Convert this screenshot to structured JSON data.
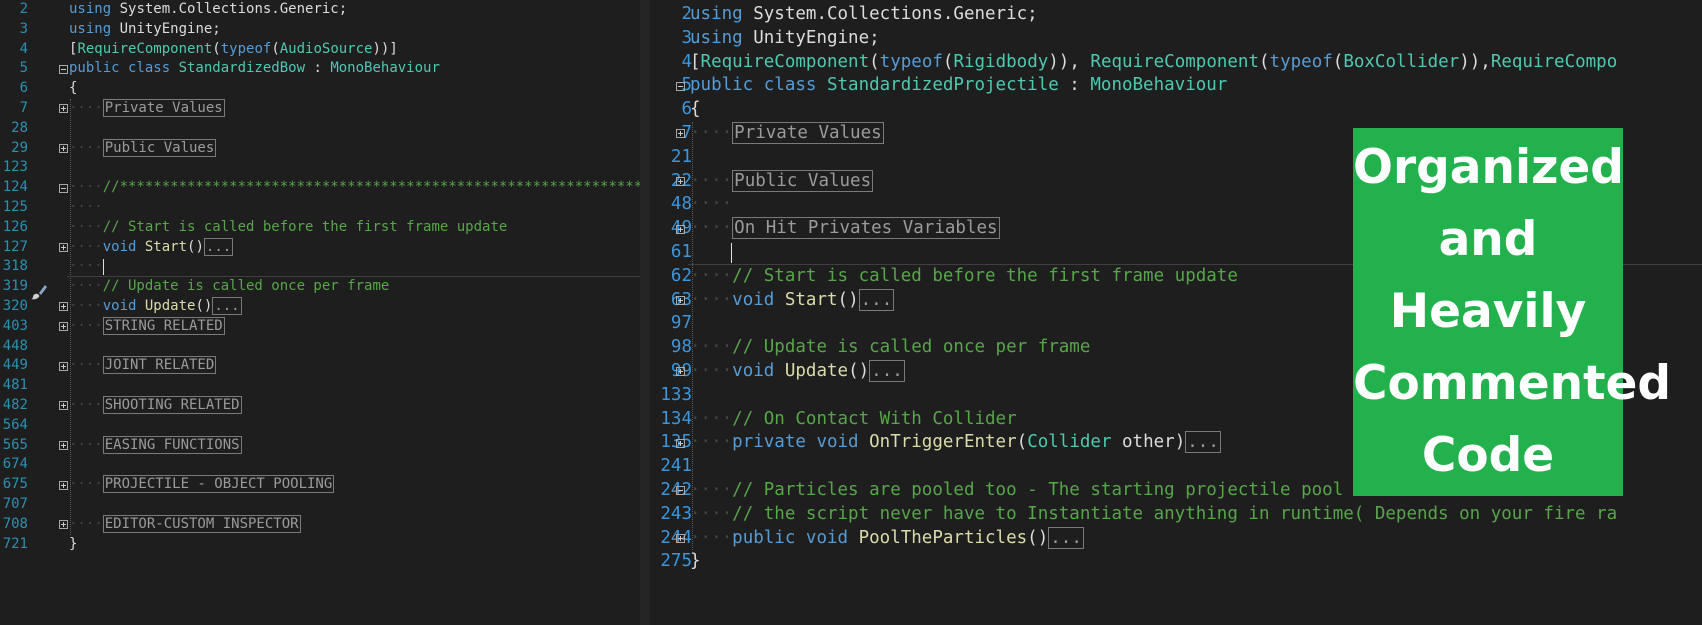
{
  "left_editor": {
    "lines": [
      {
        "num": "2",
        "fold": "",
        "indent": 0,
        "segs": [
          {
            "c": "kw",
            "t": "using"
          },
          {
            "c": "tx",
            "t": " System.Collections.Generic;"
          }
        ]
      },
      {
        "num": "3",
        "fold": "",
        "indent": 0,
        "segs": [
          {
            "c": "kw",
            "t": "using"
          },
          {
            "c": "tx",
            "t": " UnityEngine;"
          }
        ]
      },
      {
        "num": "4",
        "fold": "",
        "indent": 0,
        "segs": [
          {
            "c": "tx",
            "t": "["
          },
          {
            "c": "tp",
            "t": "RequireComponent"
          },
          {
            "c": "tx",
            "t": "("
          },
          {
            "c": "kw",
            "t": "typeof"
          },
          {
            "c": "tx",
            "t": "("
          },
          {
            "c": "tp",
            "t": "AudioSource"
          },
          {
            "c": "tx",
            "t": "))]"
          }
        ]
      },
      {
        "num": "5",
        "fold": "minus",
        "indent": 0,
        "segs": [
          {
            "c": "kw",
            "t": "public class "
          },
          {
            "c": "tp",
            "t": "StandardizedBow"
          },
          {
            "c": "tx",
            "t": " : "
          },
          {
            "c": "tp",
            "t": "MonoBehaviour"
          }
        ]
      },
      {
        "num": "6",
        "fold": "",
        "indent": 0,
        "segs": [
          {
            "c": "tx",
            "t": "{"
          }
        ]
      },
      {
        "num": "7",
        "fold": "plus",
        "indent": 1,
        "segs": [
          {
            "c": "reg",
            "t": "Private Values"
          }
        ]
      },
      {
        "num": "28",
        "fold": "",
        "indent": 0,
        "segs": []
      },
      {
        "num": "29",
        "fold": "plus",
        "indent": 1,
        "segs": [
          {
            "c": "reg",
            "t": "Public Values"
          }
        ]
      },
      {
        "num": "123",
        "fold": "",
        "indent": 0,
        "segs": []
      },
      {
        "num": "124",
        "fold": "minus",
        "indent": 1,
        "segs": [
          {
            "c": "cm",
            "t": "//*************************************************************************"
          }
        ]
      },
      {
        "num": "125",
        "fold": "",
        "indent": 1,
        "segs": []
      },
      {
        "num": "126",
        "fold": "",
        "indent": 1,
        "segs": [
          {
            "c": "cm",
            "t": "// Start is called before the first frame update"
          }
        ]
      },
      {
        "num": "127",
        "fold": "plus",
        "indent": 1,
        "segs": [
          {
            "c": "kw",
            "t": "void"
          },
          {
            "c": "tx",
            "t": " "
          },
          {
            "c": "fn",
            "t": "Start"
          },
          {
            "c": "tx",
            "t": "()"
          },
          {
            "c": "ell",
            "t": "..."
          }
        ]
      },
      {
        "num": "318",
        "fold": "",
        "indent": 1,
        "segs": []
      },
      {
        "num": "319",
        "fold": "",
        "indent": 1,
        "segs": [
          {
            "c": "cm",
            "t": "// Update is called once per frame"
          }
        ]
      },
      {
        "num": "320",
        "fold": "plus",
        "indent": 1,
        "segs": [
          {
            "c": "kw",
            "t": "void"
          },
          {
            "c": "tx",
            "t": " "
          },
          {
            "c": "fn",
            "t": "Update"
          },
          {
            "c": "tx",
            "t": "()"
          },
          {
            "c": "ell",
            "t": "..."
          }
        ]
      },
      {
        "num": "403",
        "fold": "plus",
        "indent": 1,
        "segs": [
          {
            "c": "reg",
            "t": "STRING RELATED"
          }
        ]
      },
      {
        "num": "448",
        "fold": "",
        "indent": 0,
        "segs": []
      },
      {
        "num": "449",
        "fold": "plus",
        "indent": 1,
        "segs": [
          {
            "c": "reg",
            "t": "JOINT RELATED"
          }
        ]
      },
      {
        "num": "481",
        "fold": "",
        "indent": 0,
        "segs": []
      },
      {
        "num": "482",
        "fold": "plus",
        "indent": 1,
        "segs": [
          {
            "c": "reg",
            "t": "SHOOTING RELATED"
          }
        ]
      },
      {
        "num": "564",
        "fold": "",
        "indent": 0,
        "segs": []
      },
      {
        "num": "565",
        "fold": "plus",
        "indent": 1,
        "segs": [
          {
            "c": "reg",
            "t": "EASING FUNCTIONS"
          }
        ]
      },
      {
        "num": "674",
        "fold": "",
        "indent": 0,
        "segs": []
      },
      {
        "num": "675",
        "fold": "plus",
        "indent": 1,
        "segs": [
          {
            "c": "reg",
            "t": "PROJECTILE - OBJECT POOLING"
          }
        ]
      },
      {
        "num": "707",
        "fold": "",
        "indent": 0,
        "segs": []
      },
      {
        "num": "708",
        "fold": "plus",
        "indent": 1,
        "segs": [
          {
            "c": "reg",
            "t": "EDITOR-CUSTOM INSPECTOR"
          }
        ]
      },
      {
        "num": "721",
        "fold": "",
        "indent": 0,
        "segs": [
          {
            "c": "tx",
            "t": "}"
          }
        ]
      }
    ]
  },
  "right_editor": {
    "lines": [
      {
        "num": "2",
        "fold": "",
        "indent": 0,
        "segs": [
          {
            "c": "kw",
            "t": "using"
          },
          {
            "c": "tx",
            "t": " System.Collections.Generic;"
          }
        ]
      },
      {
        "num": "3",
        "fold": "",
        "indent": 0,
        "segs": [
          {
            "c": "kw",
            "t": "using"
          },
          {
            "c": "tx",
            "t": " UnityEngine;"
          }
        ]
      },
      {
        "num": "4",
        "fold": "",
        "indent": 0,
        "segs": [
          {
            "c": "tx",
            "t": "["
          },
          {
            "c": "tp",
            "t": "RequireComponent"
          },
          {
            "c": "tx",
            "t": "("
          },
          {
            "c": "kw",
            "t": "typeof"
          },
          {
            "c": "tx",
            "t": "("
          },
          {
            "c": "tp",
            "t": "Rigidbody"
          },
          {
            "c": "tx",
            "t": ")), "
          },
          {
            "c": "tp",
            "t": "RequireComponent"
          },
          {
            "c": "tx",
            "t": "("
          },
          {
            "c": "kw",
            "t": "typeof"
          },
          {
            "c": "tx",
            "t": "("
          },
          {
            "c": "tp",
            "t": "BoxCollider"
          },
          {
            "c": "tx",
            "t": ")),"
          },
          {
            "c": "tp",
            "t": "RequireCompo"
          }
        ]
      },
      {
        "num": "5",
        "fold": "minus",
        "indent": 0,
        "segs": [
          {
            "c": "kw",
            "t": "public class "
          },
          {
            "c": "tp",
            "t": "StandardizedProjectile"
          },
          {
            "c": "tx",
            "t": " : "
          },
          {
            "c": "tp",
            "t": "MonoBehaviour"
          }
        ]
      },
      {
        "num": "6",
        "fold": "",
        "indent": 0,
        "segs": [
          {
            "c": "tx",
            "t": "{"
          }
        ]
      },
      {
        "num": "7",
        "fold": "plus",
        "indent": 1,
        "segs": [
          {
            "c": "reg",
            "t": "Private Values"
          }
        ]
      },
      {
        "num": "21",
        "fold": "",
        "indent": 0,
        "segs": []
      },
      {
        "num": "22",
        "fold": "plus",
        "indent": 1,
        "segs": [
          {
            "c": "reg",
            "t": "Public Values"
          }
        ]
      },
      {
        "num": "48",
        "fold": "",
        "indent": 1,
        "segs": []
      },
      {
        "num": "49",
        "fold": "plus",
        "indent": 1,
        "segs": [
          {
            "c": "reg",
            "t": "On Hit Privates Variables"
          }
        ]
      },
      {
        "num": "61",
        "fold": "",
        "indent": 0,
        "segs": []
      },
      {
        "num": "62",
        "fold": "",
        "indent": 1,
        "segs": [
          {
            "c": "cm",
            "t": "// Start is called before the first frame update"
          }
        ]
      },
      {
        "num": "63",
        "fold": "plus",
        "indent": 1,
        "segs": [
          {
            "c": "kw",
            "t": "void"
          },
          {
            "c": "tx",
            "t": " "
          },
          {
            "c": "fn",
            "t": "Start"
          },
          {
            "c": "tx",
            "t": "()"
          },
          {
            "c": "ell",
            "t": "..."
          }
        ]
      },
      {
        "num": "97",
        "fold": "",
        "indent": 0,
        "segs": []
      },
      {
        "num": "98",
        "fold": "",
        "indent": 1,
        "segs": [
          {
            "c": "cm",
            "t": "// Update is called once per frame"
          }
        ]
      },
      {
        "num": "99",
        "fold": "plus",
        "indent": 1,
        "segs": [
          {
            "c": "kw",
            "t": "void"
          },
          {
            "c": "tx",
            "t": " "
          },
          {
            "c": "fn",
            "t": "Update"
          },
          {
            "c": "tx",
            "t": "()"
          },
          {
            "c": "ell",
            "t": "..."
          }
        ]
      },
      {
        "num": "133",
        "fold": "",
        "indent": 0,
        "segs": []
      },
      {
        "num": "134",
        "fold": "",
        "indent": 1,
        "segs": [
          {
            "c": "cm",
            "t": "// On Contact With Collider"
          }
        ]
      },
      {
        "num": "135",
        "fold": "plus",
        "indent": 1,
        "segs": [
          {
            "c": "kw",
            "t": "private void "
          },
          {
            "c": "fn",
            "t": "OnTriggerEnter"
          },
          {
            "c": "tx",
            "t": "("
          },
          {
            "c": "tp",
            "t": "Collider"
          },
          {
            "c": "tx",
            "t": " other)"
          },
          {
            "c": "ell",
            "t": "..."
          }
        ]
      },
      {
        "num": "241",
        "fold": "",
        "indent": 0,
        "segs": []
      },
      {
        "num": "242",
        "fold": "minus",
        "indent": 1,
        "segs": [
          {
            "c": "cm",
            "t": "// Particles are pooled too - The starting projectile pool size in Standardize Bows"
          }
        ]
      },
      {
        "num": "243",
        "fold": "",
        "indent": 1,
        "segs": [
          {
            "c": "cm",
            "t": "// the script never have to Instantiate anything in runtime( Depends on your fire ra"
          }
        ]
      },
      {
        "num": "244",
        "fold": "plus",
        "indent": 1,
        "segs": [
          {
            "c": "kw",
            "t": "public void "
          },
          {
            "c": "fn",
            "t": "PoolTheParticles"
          },
          {
            "c": "tx",
            "t": "()"
          },
          {
            "c": "ell",
            "t": "..."
          }
        ]
      },
      {
        "num": "275",
        "fold": "",
        "indent": 0,
        "segs": [
          {
            "c": "tx",
            "t": "}"
          }
        ]
      }
    ]
  },
  "banner": {
    "lines": [
      "Organized",
      "and",
      "Heavily",
      "Commented",
      "Code"
    ],
    "color": "#22b14c"
  },
  "icons": {
    "breakpoint_brush": "paintbrush-icon"
  }
}
